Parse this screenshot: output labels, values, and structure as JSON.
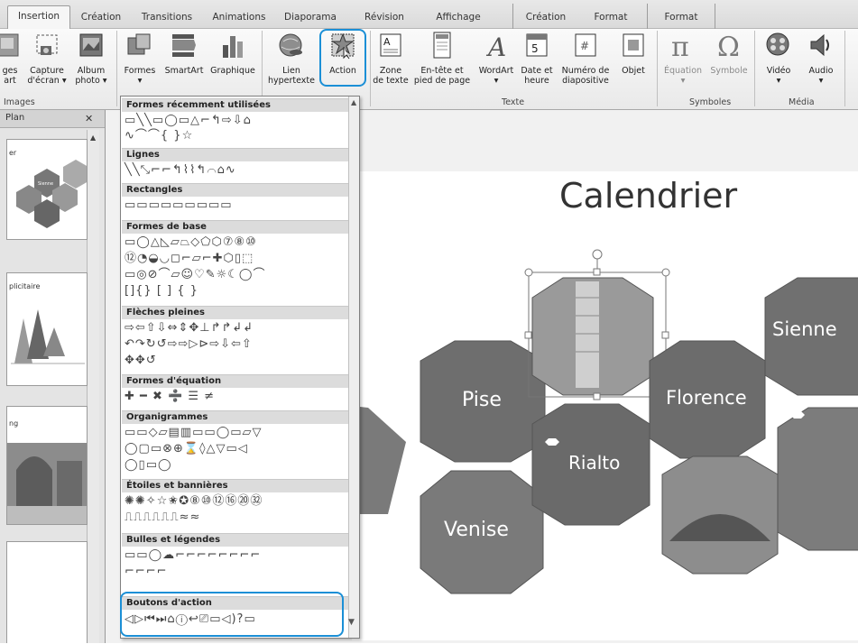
{
  "tabs": [
    {
      "label": "Insertion",
      "active": true
    },
    {
      "label": "Création",
      "active": false
    },
    {
      "label": "Transitions",
      "active": false
    },
    {
      "label": "Animations",
      "active": false
    },
    {
      "label": "Diaporama",
      "active": false
    },
    {
      "label": "Révision",
      "active": false
    },
    {
      "label": "Affichage",
      "active": false
    },
    {
      "label": "Création",
      "active": false
    },
    {
      "label": "Format",
      "active": false
    },
    {
      "label": "Format",
      "active": false
    }
  ],
  "ribbon": {
    "images": {
      "images_l1": "ges",
      "images_l2": "art",
      "capture_l1": "Capture",
      "capture_l2": "d'écran ▾",
      "album_l1": "Album",
      "album_l2": "photo ▾",
      "group": "Images"
    },
    "illus": {
      "formes_l1": "Formes",
      "formes_l2": "▾",
      "smartart": "SmartArt",
      "graphique": "Graphique"
    },
    "liens": {
      "lien_l1": "Lien",
      "lien_l2": "hypertexte",
      "action": "Action"
    },
    "texte": {
      "zone_l1": "Zone",
      "zone_l2": "de texte",
      "entete_l1": "En-tête et",
      "entete_l2": "pied de page",
      "wordart_l1": "WordArt",
      "wordart_l2": "▾",
      "date_l1": "Date et",
      "date_l2": "heure",
      "numero_l1": "Numéro de",
      "numero_l2": "diapositive",
      "objet": "Objet",
      "group": "Texte"
    },
    "symboles": {
      "equation_l1": "Équation",
      "equation_l2": "▾",
      "symbole": "Symbole",
      "group": "Symboles"
    },
    "media": {
      "video_l1": "Vidéo",
      "video_l2": "▾",
      "audio_l1": "Audio",
      "audio_l2": "▾",
      "group": "Média"
    }
  },
  "leftpane": {
    "header": "Plan",
    "close": "✕",
    "thumb1_text": "er",
    "thumb1_badge": "Sienne",
    "thumb2_text": "plicitaire",
    "thumb3_text": "ng"
  },
  "gallery": {
    "sections": [
      {
        "title": "Formes récemment utilisées",
        "rows": [
          "▭╲╲▭◯▭△⌐↰⇨⇩⌂",
          "∿⌒⌒{ }☆"
        ]
      },
      {
        "title": "Lignes",
        "rows": [
          "╲╲⤡⌐⌐↰⌇⌇↰⌒⌂∿"
        ]
      },
      {
        "title": "Rectangles",
        "rows": [
          "▭▭▭▭▭▭▭▭▭"
        ]
      },
      {
        "title": "Formes de base",
        "rows": [
          "▭◯△◺▱⏢◇⬠⬡⑦⑧⑩",
          "⑫◔◒◡◻⌐▱⌐✚⬡▯⬚",
          "▭◎⊘⌒▱☺♡✎☼☾◯⌒",
          "[]{} [ ] { }"
        ]
      },
      {
        "title": "Flèches pleines",
        "rows": [
          "⇨⇦⇧⇩⇔⇕✥⊥↱↱↲↲",
          "↶↷↻↺⇨⇨▷⊳⇨⇩⇦⇧",
          "✥✥↺"
        ]
      },
      {
        "title": "Formes d'équation",
        "rows": [
          "✚ ━ ✖ ➗ ☰ ≠"
        ]
      },
      {
        "title": "Organigrammes",
        "rows": [
          "▭▭◇▱▤▥▭▭◯▭▱▽",
          "◯▢▭⊗⊕⌛◊△▽▭◁",
          "◯▯▭◯"
        ]
      },
      {
        "title": "Étoiles et bannières",
        "rows": [
          "✺✺✧☆✬✪⑧⑩⑫⑯⑳㉜",
          "⎍⎍⎍⎍⎍⎍≈≈"
        ]
      },
      {
        "title": "Bulles et légendes",
        "rows": [
          "▭▭◯☁⌐⌐⌐⌐⌐⌐⌐⌐",
          "⌐⌐⌐⌐"
        ]
      },
      {
        "title": "Boutons d'action",
        "rows": [
          "◁▷⏮⏭⌂ⓘ↩⎚▭◁)?▭"
        ]
      }
    ]
  },
  "slide": {
    "title": "Calendrier",
    "hexagons": [
      "Pise",
      "Florence",
      "Rialto",
      "Venise",
      "Sienne"
    ]
  }
}
